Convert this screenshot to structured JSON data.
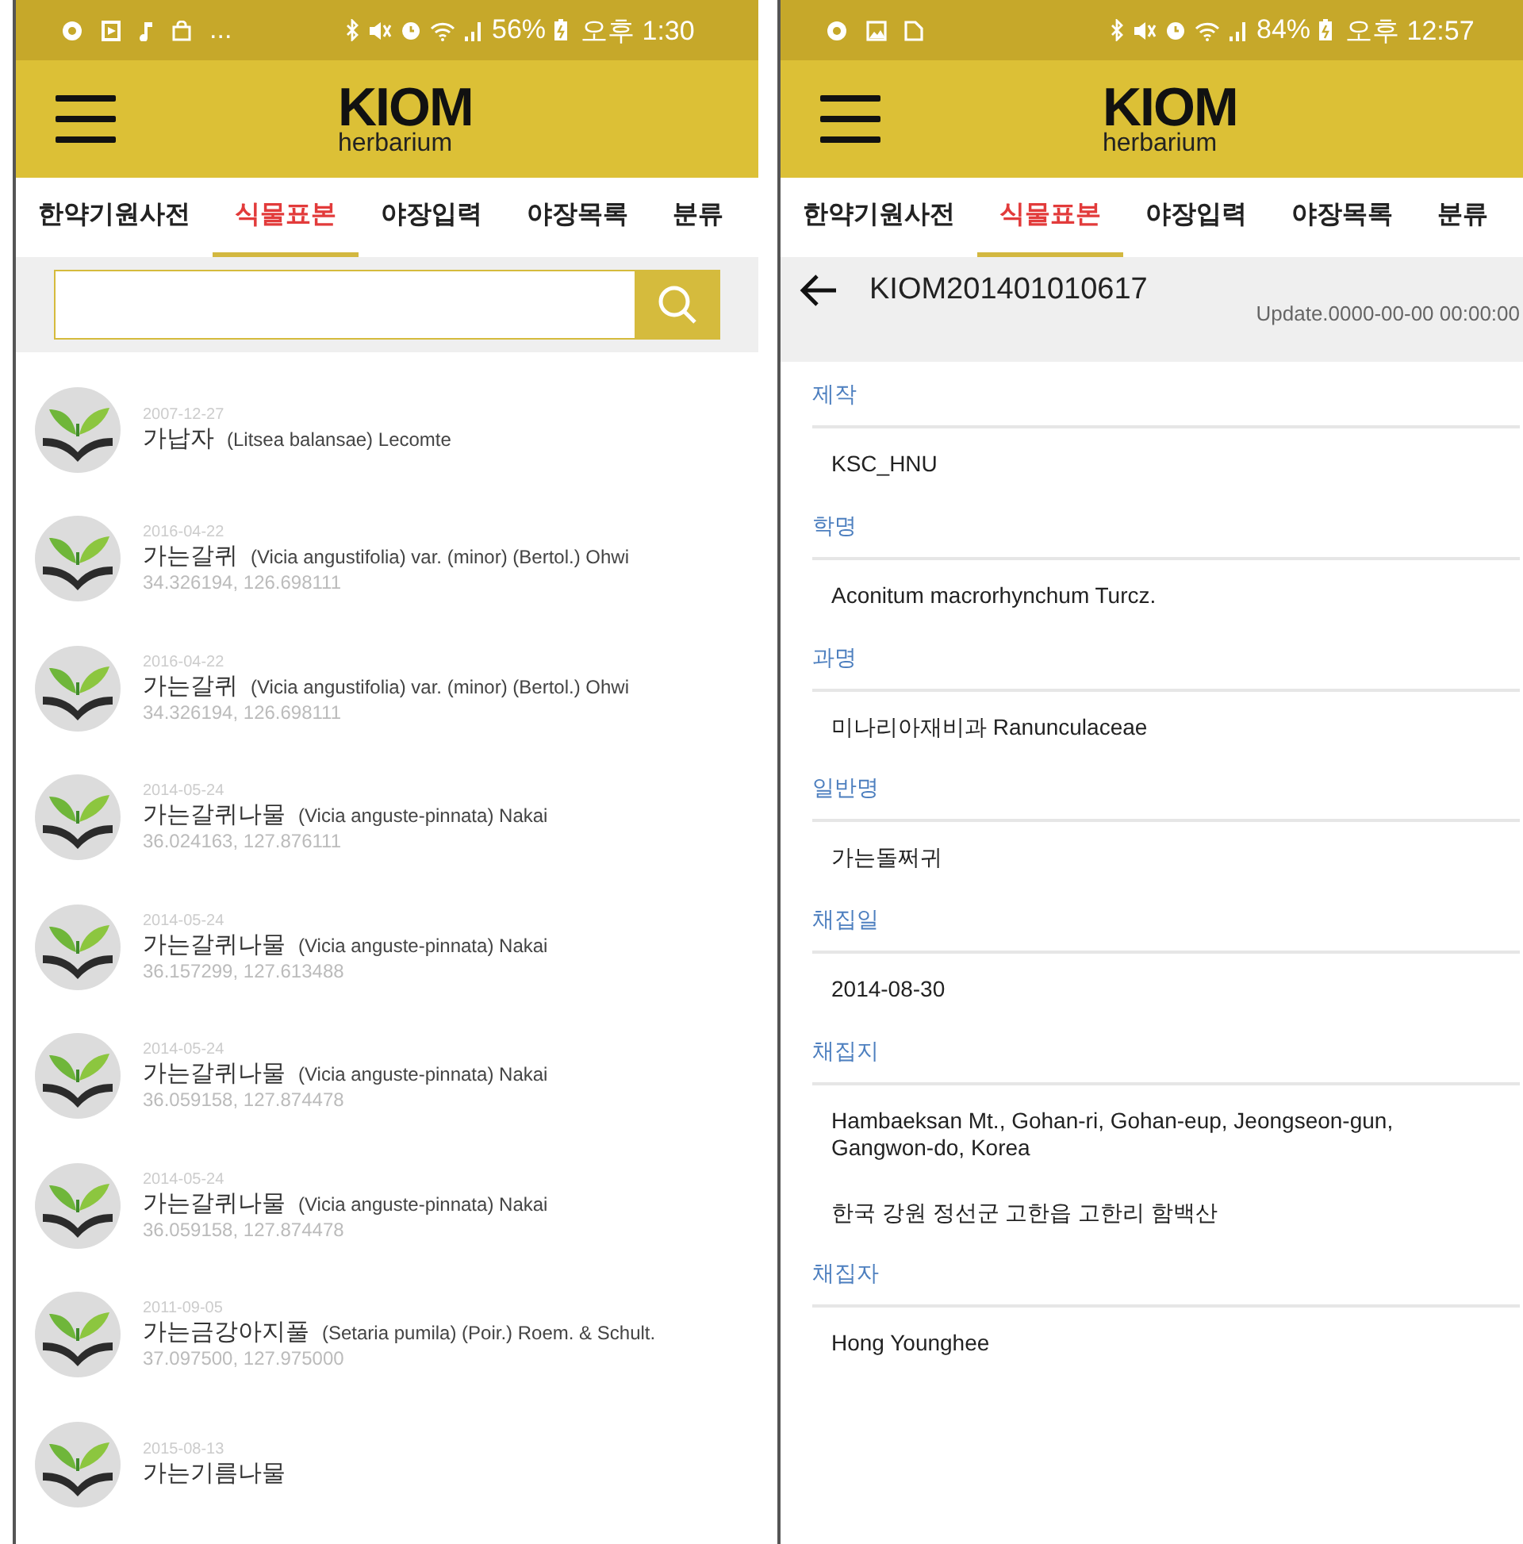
{
  "screens": [
    {
      "kind": "list",
      "status_bar": {
        "overflow": "...",
        "battery": "56%",
        "time": "오후 1:30"
      },
      "logo": {
        "title": "KIOM",
        "subtitle": "herbarium"
      },
      "tabs": [
        {
          "label": "한약기원사전",
          "selected": false
        },
        {
          "label": "식물표본",
          "selected": true
        },
        {
          "label": "야장입력",
          "selected": false
        },
        {
          "label": "야장목록",
          "selected": false
        },
        {
          "label": "분류",
          "selected": false
        }
      ],
      "specimens": [
        {
          "date": "2007-12-27",
          "name": "가납자",
          "scientific": "(Litsea balansae) Lecomte"
        },
        {
          "date": "2016-04-22",
          "name": "가는갈퀴",
          "scientific": "(Vicia angustifolia) var. (minor) (Bertol.) Ohwi",
          "coords": "34.326194, 126.698111"
        },
        {
          "date": "2016-04-22",
          "name": "가는갈퀴",
          "scientific": "(Vicia angustifolia) var. (minor) (Bertol.) Ohwi",
          "coords": "34.326194, 126.698111"
        },
        {
          "date": "2014-05-24",
          "name": "가는갈퀴나물",
          "scientific": "(Vicia anguste-pinnata) Nakai",
          "coords": "36.024163, 127.876111"
        },
        {
          "date": "2014-05-24",
          "name": "가는갈퀴나물",
          "scientific": "(Vicia anguste-pinnata) Nakai",
          "coords": "36.157299, 127.613488"
        },
        {
          "date": "2014-05-24",
          "name": "가는갈퀴나물",
          "scientific": "(Vicia anguste-pinnata) Nakai",
          "coords": "36.059158, 127.874478"
        },
        {
          "date": "2014-05-24",
          "name": "가는갈퀴나물",
          "scientific": "(Vicia anguste-pinnata) Nakai",
          "coords": "36.059158, 127.874478"
        },
        {
          "date": "2011-09-05",
          "name": "가는금강아지풀",
          "scientific": "(Setaria pumila) (Poir.) Roem. & Schult.",
          "coords": "37.097500, 127.975000"
        },
        {
          "date": "2015-08-13",
          "name": "가는기름나물"
        }
      ]
    },
    {
      "kind": "detail",
      "status_bar": {
        "battery": "84%",
        "time": "오후 12:57"
      },
      "logo": {
        "title": "KIOM",
        "subtitle": "herbarium"
      },
      "tabs": [
        {
          "label": "한약기원사전",
          "selected": false
        },
        {
          "label": "식물표본",
          "selected": true
        },
        {
          "label": "야장입력",
          "selected": false
        },
        {
          "label": "야장목록",
          "selected": false
        },
        {
          "label": "분류",
          "selected": false
        }
      ],
      "record": {
        "id": "KIOM201401010617",
        "updated": "Update.0000-00-00 00:00:00"
      },
      "fields": [
        {
          "label": "제작",
          "values": [
            "KSC_HNU"
          ]
        },
        {
          "label": "학명",
          "values": [
            "Aconitum macrorhynchum Turcz."
          ]
        },
        {
          "label": "과명",
          "values": [
            "미나리아재비과 Ranunculaceae"
          ]
        },
        {
          "label": "일반명",
          "values": [
            "가는돌쩌귀"
          ]
        },
        {
          "label": "채집일",
          "values": [
            "2014-08-30"
          ]
        },
        {
          "label": "채집지",
          "values": [
            "Hambaeksan Mt., Gohan-ri, Gohan-eup, Jeongseon-gun, Gangwon-do, Korea",
            "한국 강원 정선군 고한읍 고한리 함백산"
          ]
        },
        {
          "label": "채집자",
          "values": [
            "Hong Younghee"
          ]
        }
      ]
    }
  ]
}
